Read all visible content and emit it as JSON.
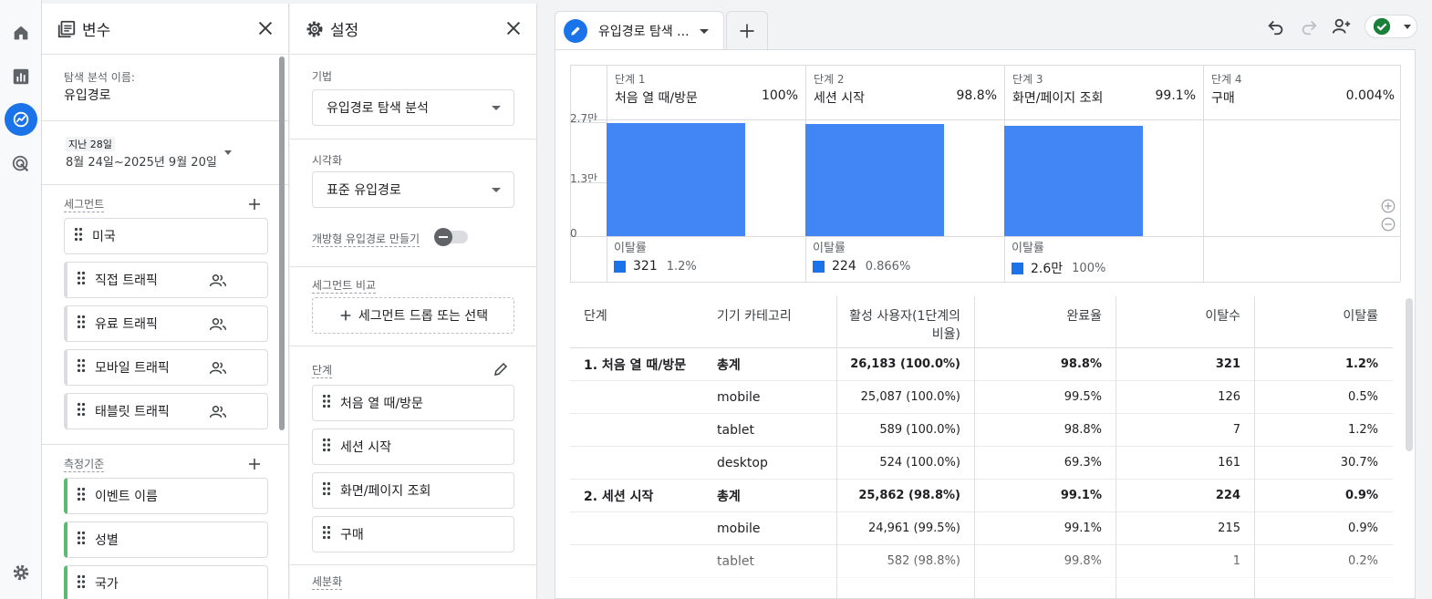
{
  "rail": {
    "items": [
      {
        "icon": "home-icon"
      },
      {
        "icon": "reports-icon"
      },
      {
        "icon": "explore-icon",
        "active": true
      },
      {
        "icon": "advertising-icon"
      }
    ],
    "settings_icon": "gear-icon"
  },
  "variables_panel": {
    "title": "변수",
    "exploration_name_label": "탐색 분석 이름:",
    "exploration_name": "유입경로",
    "date_chip": "지난 28일",
    "date_range": "8월 24일~2025년 9월 20일",
    "segments_label": "세그먼트",
    "segments": [
      {
        "label": "미국",
        "people": false
      },
      {
        "label": "직접 트래픽",
        "people": true
      },
      {
        "label": "유료 트래픽",
        "people": true
      },
      {
        "label": "모바일 트래픽",
        "people": true
      },
      {
        "label": "태블릿 트래픽",
        "people": true
      }
    ],
    "dimensions_label": "측정기준",
    "dimensions": [
      "이벤트 이름",
      "성별",
      "국가"
    ]
  },
  "settings_panel": {
    "title": "설정",
    "technique_label": "기법",
    "technique_value": "유입경로 탐색 분석",
    "visualization_label": "시각화",
    "visualization_value": "표준 유입경로",
    "open_funnel_label": "개방형 유입경로 만들기",
    "open_funnel_on": false,
    "segment_compare_label": "세그먼트 비교",
    "segment_drop_label": "세그먼트 드롭 또는 선택",
    "steps_label": "단계",
    "steps": [
      "처음 열 때/방문",
      "세션 시작",
      "화면/페이지 조회",
      "구매"
    ],
    "breakdown_label": "세분화"
  },
  "main": {
    "tab_label": "유입경로 탐색 ...",
    "colors": {
      "accent": "#1a73e8",
      "bar": "#4285f4",
      "success": "#188038"
    }
  },
  "chart_data": {
    "type": "bar",
    "categories": [
      "처음 열 때/방문",
      "세션 시작",
      "화면/페이지 조회",
      "구매"
    ],
    "step_labels": [
      "단계 1",
      "단계 2",
      "단계 3",
      "단계 4"
    ],
    "step_percents": [
      "100%",
      "98.8%",
      "99.1%",
      "0.004%"
    ],
    "values": [
      26183,
      25862,
      25623,
      1
    ],
    "y_ticks": [
      {
        "value": 0,
        "label": "0"
      },
      {
        "value": 13000,
        "label": "1.3만"
      },
      {
        "value": 27000,
        "label": "2.7만"
      }
    ],
    "ylim": [
      0,
      27000
    ],
    "abandon_label": "이탈률",
    "abandonment": [
      {
        "count": "321",
        "rate": "1.2%"
      },
      {
        "count": "224",
        "rate": "0.866%"
      },
      {
        "count": "2.6만",
        "rate": "100%"
      }
    ]
  },
  "table": {
    "headers": [
      "단계",
      "기기 카테고리",
      "활성 사용자(1단계의 비율)",
      "완료율",
      "이탈수",
      "이탈률"
    ],
    "rows": [
      {
        "step": "1. 처음 열 때/방문",
        "device": "총계",
        "users": "26,183 (100.0%)",
        "completion": "98.8%",
        "abandons": "321",
        "rate": "1.2%",
        "bold": true
      },
      {
        "step": "",
        "device": "mobile",
        "users": "25,087 (100.0%)",
        "completion": "99.5%",
        "abandons": "126",
        "rate": "0.5%",
        "bold": false
      },
      {
        "step": "",
        "device": "tablet",
        "users": "589 (100.0%)",
        "completion": "98.8%",
        "abandons": "7",
        "rate": "1.2%",
        "bold": false
      },
      {
        "step": "",
        "device": "desktop",
        "users": "524 (100.0%)",
        "completion": "69.3%",
        "abandons": "161",
        "rate": "30.7%",
        "bold": false
      },
      {
        "step": "2. 세션 시작",
        "device": "총계",
        "users": "25,862 (98.8%)",
        "completion": "99.1%",
        "abandons": "224",
        "rate": "0.9%",
        "bold": true
      },
      {
        "step": "",
        "device": "mobile",
        "users": "24,961 (99.5%)",
        "completion": "99.1%",
        "abandons": "215",
        "rate": "0.9%",
        "bold": false
      },
      {
        "step": "",
        "device": "tablet",
        "users": "582 (98.8%)",
        "completion": "99.8%",
        "abandons": "1",
        "rate": "0.2%",
        "bold": false
      }
    ]
  }
}
